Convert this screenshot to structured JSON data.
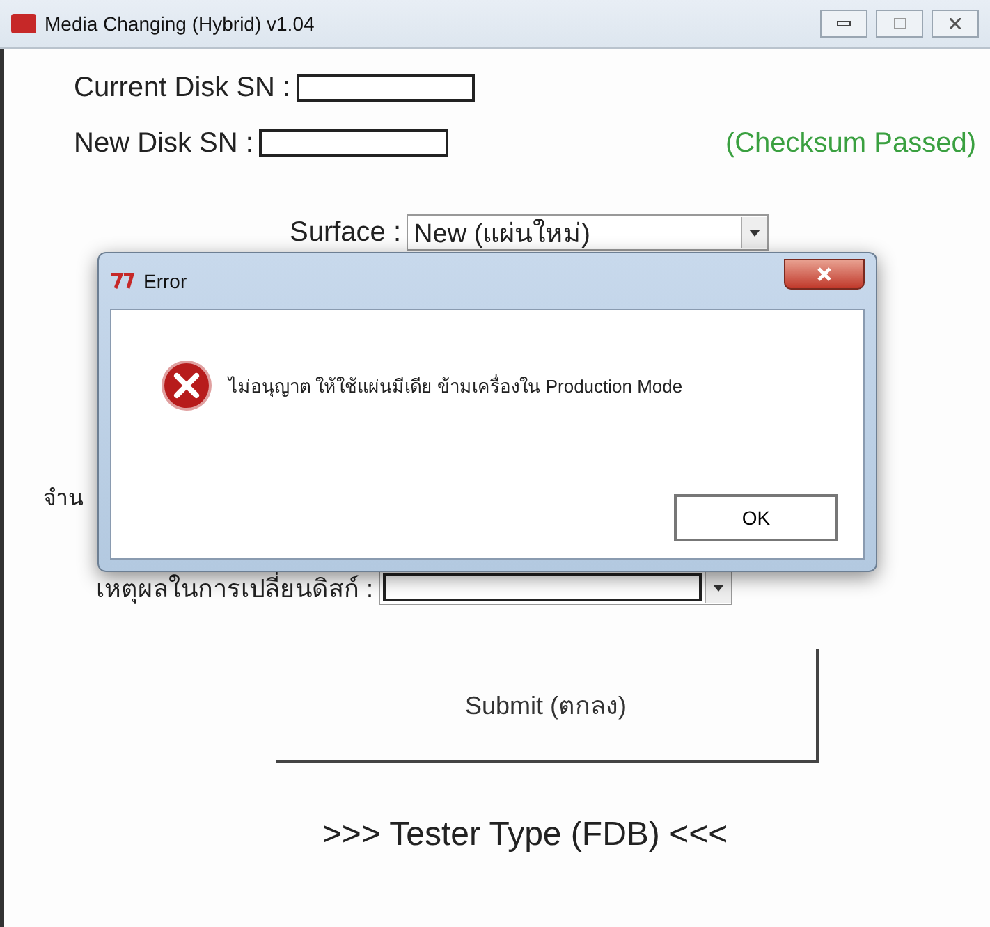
{
  "window": {
    "title": "Media Changing (Hybrid) v1.04"
  },
  "fields": [
    {
      "label": "Current Disk SN :",
      "kind": "text"
    },
    {
      "label": "New Disk SN :",
      "kind": "text",
      "status": "(Checksum Passed)"
    }
  ],
  "surface": {
    "label": "Surface :",
    "value": "New (แผ่นใหม่)"
  },
  "partial_label": "จำน",
  "reason": {
    "label": "เหตุผลในการเปลี่ยนดิสก์ :"
  },
  "submit": "Submit (ตกลง)",
  "footer": ">>> Tester Type (FDB) <<<",
  "dialog": {
    "title": "Error",
    "message": "ไม่อนุญาต ให้ใช้แผ่นมีเดีย ข้ามเครื่องใน Production Mode",
    "button": "OK"
  }
}
